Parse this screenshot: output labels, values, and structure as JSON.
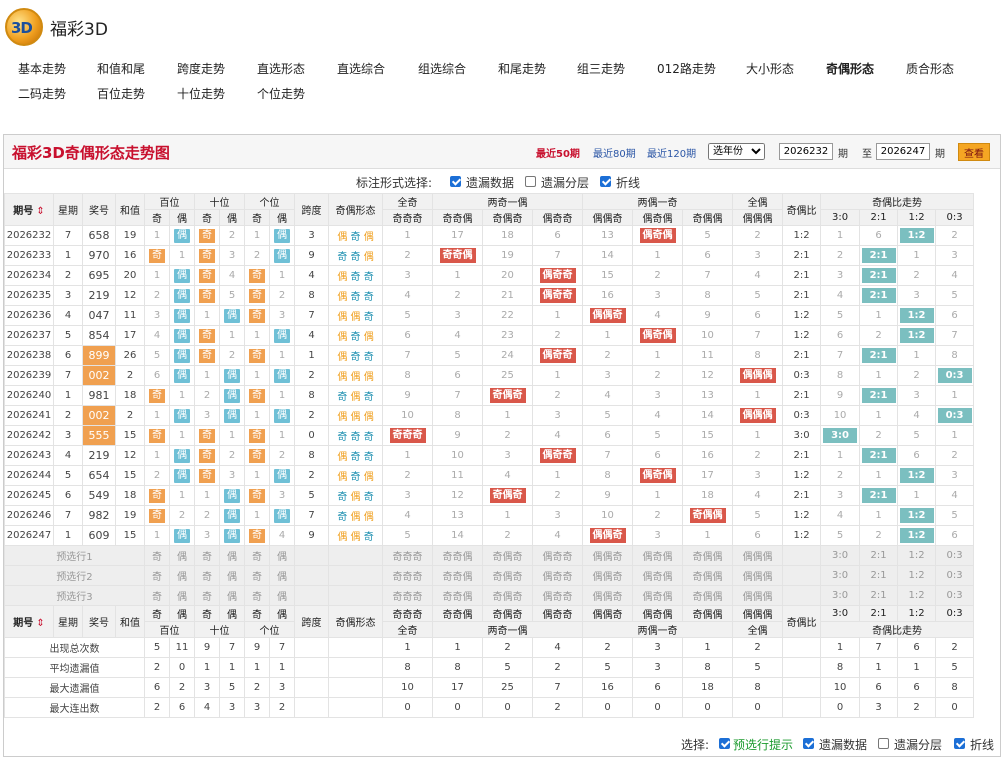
{
  "header": {
    "title": "福彩3D",
    "logo_text": "3D"
  },
  "nav": [
    "基本走势",
    "和值和尾",
    "跨度走势",
    "直选形态",
    "直选综合",
    "组选综合",
    "和尾走势",
    "组三走势",
    "012路走势",
    "大小形态",
    "奇偶形态",
    "质合形态",
    "二码走势",
    "百位走势",
    "十位走势",
    "个位走势"
  ],
  "nav_active": "奇偶形态",
  "panel": {
    "title": "福彩3D奇偶形态走势图",
    "links": [
      "最近50期",
      "最近80期",
      "最近120期"
    ],
    "year_select": "选年份",
    "from": "2026232",
    "to": "2026247",
    "qi1": "期",
    "zhi": "至",
    "qi2": "期",
    "btn": "查看"
  },
  "options": {
    "label": "标注形式选择:",
    "items": [
      {
        "label": "遗漏数据",
        "checked": true
      },
      {
        "label": "遗漏分层",
        "checked": false
      },
      {
        "label": "折线",
        "checked": true
      }
    ]
  },
  "table": {
    "head1": [
      "期号",
      "星期",
      "奖号",
      "和值",
      "百位",
      "十位",
      "个位",
      "跨度",
      "奇偶形态",
      "全奇",
      "两奇一偶",
      "两偶一奇",
      "全偶",
      "奇偶比",
      "奇偶比走势"
    ],
    "head2": [
      "奇",
      "偶",
      "奇",
      "偶",
      "奇",
      "偶",
      "奇奇奇",
      "奇奇偶",
      "奇偶奇",
      "偶奇奇",
      "偶偶奇",
      "偶奇偶",
      "奇偶偶",
      "偶偶偶",
      "3:0",
      "2:1",
      "1:2",
      "0:3"
    ],
    "rows": [
      {
        "p": "2026232",
        "w": "7",
        "n": "658",
        "s": "19",
        "pos": [
          [
            1,
            "偶"
          ],
          [
            "奇",
            2
          ],
          [
            1,
            "偶"
          ]
        ],
        "k": "3",
        "f": "偶奇偶",
        "c": [
          "1",
          "17",
          "18",
          "6",
          "13",
          "偶奇偶",
          "5",
          "2"
        ],
        "r": "1:2",
        "rt": [
          "1",
          "6",
          "1:2",
          "2"
        ]
      },
      {
        "p": "2026233",
        "w": "1",
        "n": "970",
        "s": "16",
        "pos": [
          [
            "奇",
            1
          ],
          [
            "奇",
            3
          ],
          [
            2,
            "偶"
          ]
        ],
        "k": "9",
        "f": "奇奇偶",
        "c": [
          "2",
          "奇奇偶",
          "19",
          "7",
          "14",
          "1",
          "6",
          "3"
        ],
        "r": "2:1",
        "rt": [
          "2",
          "2:1",
          "1",
          "3"
        ]
      },
      {
        "p": "2026234",
        "w": "2",
        "n": "695",
        "s": "20",
        "pos": [
          [
            1,
            "偶"
          ],
          [
            "奇",
            4
          ],
          [
            "奇",
            1
          ]
        ],
        "k": "4",
        "f": "偶奇奇",
        "c": [
          "3",
          "1",
          "20",
          "偶奇奇",
          "15",
          "2",
          "7",
          "4"
        ],
        "r": "2:1",
        "rt": [
          "3",
          "2:1",
          "2",
          "4"
        ]
      },
      {
        "p": "2026235",
        "w": "3",
        "n": "219",
        "s": "12",
        "pos": [
          [
            2,
            "偶"
          ],
          [
            "奇",
            5
          ],
          [
            "奇",
            2
          ]
        ],
        "k": "8",
        "f": "偶奇奇",
        "c": [
          "4",
          "2",
          "21",
          "偶奇奇",
          "16",
          "3",
          "8",
          "5"
        ],
        "r": "2:1",
        "rt": [
          "4",
          "2:1",
          "3",
          "5"
        ]
      },
      {
        "p": "2026236",
        "w": "4",
        "n": "047",
        "s": "11",
        "pos": [
          [
            3,
            "偶"
          ],
          [
            1,
            "偶"
          ],
          [
            "奇",
            3
          ]
        ],
        "k": "7",
        "f": "偶偶奇",
        "c": [
          "5",
          "3",
          "22",
          "1",
          "偶偶奇",
          "4",
          "9",
          "6"
        ],
        "r": "1:2",
        "rt": [
          "5",
          "1",
          "1:2",
          "6"
        ]
      },
      {
        "p": "2026237",
        "w": "5",
        "n": "854",
        "s": "17",
        "pos": [
          [
            4,
            "偶"
          ],
          [
            "奇",
            1
          ],
          [
            1,
            "偶"
          ]
        ],
        "k": "4",
        "f": "偶奇偶",
        "c": [
          "6",
          "4",
          "23",
          "2",
          "1",
          "偶奇偶",
          "10",
          "7"
        ],
        "r": "1:2",
        "rt": [
          "6",
          "2",
          "1:2",
          "7"
        ]
      },
      {
        "p": "2026238",
        "w": "6",
        "n": "899",
        "s": "26",
        "pos": [
          [
            5,
            "偶"
          ],
          [
            "奇",
            2
          ],
          [
            "奇",
            1
          ]
        ],
        "k": "1",
        "f": "偶奇奇",
        "c": [
          "7",
          "5",
          "24",
          "偶奇奇",
          "2",
          "1",
          "11",
          "8"
        ],
        "r": "2:1",
        "rt": [
          "7",
          "2:1",
          "1",
          "8"
        ]
      },
      {
        "p": "2026239",
        "w": "7",
        "n": "002",
        "s": "2",
        "pos": [
          [
            6,
            "偶"
          ],
          [
            1,
            "偶"
          ],
          [
            1,
            "偶"
          ]
        ],
        "k": "2",
        "f": "偶偶偶",
        "c": [
          "8",
          "6",
          "25",
          "1",
          "3",
          "2",
          "12",
          "偶偶偶"
        ],
        "r": "0:3",
        "rt": [
          "8",
          "1",
          "2",
          "0:3"
        ]
      },
      {
        "p": "2026240",
        "w": "1",
        "n": "981",
        "s": "18",
        "pos": [
          [
            "奇",
            1
          ],
          [
            2,
            "偶"
          ],
          [
            "奇",
            1
          ]
        ],
        "k": "8",
        "f": "奇偶奇",
        "c": [
          "9",
          "7",
          "奇偶奇",
          "2",
          "4",
          "3",
          "13",
          "1"
        ],
        "r": "2:1",
        "rt": [
          "9",
          "2:1",
          "3",
          "1"
        ]
      },
      {
        "p": "2026241",
        "w": "2",
        "n": "002",
        "s": "2",
        "pos": [
          [
            1,
            "偶"
          ],
          [
            3,
            "偶"
          ],
          [
            1,
            "偶"
          ]
        ],
        "k": "2",
        "f": "偶偶偶",
        "c": [
          "10",
          "8",
          "1",
          "3",
          "5",
          "4",
          "14",
          "偶偶偶"
        ],
        "r": "0:3",
        "rt": [
          "10",
          "1",
          "4",
          "0:3"
        ]
      },
      {
        "p": "2026242",
        "w": "3",
        "n": "555",
        "s": "15",
        "pos": [
          [
            "奇",
            1
          ],
          [
            "奇",
            1
          ],
          [
            "奇",
            1
          ]
        ],
        "k": "0",
        "f": "奇奇奇",
        "c": [
          "奇奇奇",
          "9",
          "2",
          "4",
          "6",
          "5",
          "15",
          "1"
        ],
        "r": "3:0",
        "rt": [
          "3:0",
          "2",
          "5",
          "1"
        ]
      },
      {
        "p": "2026243",
        "w": "4",
        "n": "219",
        "s": "12",
        "pos": [
          [
            1,
            "偶"
          ],
          [
            "奇",
            2
          ],
          [
            "奇",
            2
          ]
        ],
        "k": "8",
        "f": "偶奇奇",
        "c": [
          "1",
          "10",
          "3",
          "偶奇奇",
          "7",
          "6",
          "16",
          "2"
        ],
        "r": "2:1",
        "rt": [
          "1",
          "2:1",
          "6",
          "2"
        ]
      },
      {
        "p": "2026244",
        "w": "5",
        "n": "654",
        "s": "15",
        "pos": [
          [
            2,
            "偶"
          ],
          [
            "奇",
            3
          ],
          [
            1,
            "偶"
          ]
        ],
        "k": "2",
        "f": "偶奇偶",
        "c": [
          "2",
          "11",
          "4",
          "1",
          "8",
          "偶奇偶",
          "17",
          "3"
        ],
        "r": "1:2",
        "rt": [
          "2",
          "1",
          "1:2",
          "3"
        ]
      },
      {
        "p": "2026245",
        "w": "6",
        "n": "549",
        "s": "18",
        "pos": [
          [
            "奇",
            1
          ],
          [
            1,
            "偶"
          ],
          [
            "奇",
            3
          ]
        ],
        "k": "5",
        "f": "奇偶奇",
        "c": [
          "3",
          "12",
          "奇偶奇",
          "2",
          "9",
          "1",
          "18",
          "4"
        ],
        "r": "2:1",
        "rt": [
          "3",
          "2:1",
          "1",
          "4"
        ]
      },
      {
        "p": "2026246",
        "w": "7",
        "n": "982",
        "s": "19",
        "pos": [
          [
            "奇",
            2
          ],
          [
            2,
            "偶"
          ],
          [
            1,
            "偶"
          ]
        ],
        "k": "7",
        "f": "奇偶偶",
        "c": [
          "4",
          "13",
          "1",
          "3",
          "10",
          "2",
          "奇偶偶",
          "5"
        ],
        "r": "1:2",
        "rt": [
          "4",
          "1",
          "1:2",
          "5"
        ]
      },
      {
        "p": "2026247",
        "w": "1",
        "n": "609",
        "s": "15",
        "pos": [
          [
            1,
            "偶"
          ],
          [
            3,
            "偶"
          ],
          [
            "奇",
            4
          ]
        ],
        "k": "9",
        "f": "偶偶奇",
        "c": [
          "5",
          "14",
          "2",
          "4",
          "偶偶奇",
          "3",
          "1",
          "6"
        ],
        "r": "1:2",
        "rt": [
          "5",
          "2",
          "1:2",
          "6"
        ]
      }
    ],
    "pre": [
      "预选行1",
      "预选行2",
      "预选行3"
    ],
    "stats": [
      {
        "l": "出现总次数",
        "v": [
          "5",
          "11",
          "9",
          "7",
          "9",
          "7"
        ],
        "c": [
          "1",
          "1",
          "2",
          "4",
          "2",
          "3",
          "1",
          "2"
        ],
        "rt": [
          "1",
          "7",
          "6",
          "2"
        ]
      },
      {
        "l": "平均遗漏值",
        "v": [
          "2",
          "0",
          "1",
          "1",
          "1",
          "1"
        ],
        "c": [
          "8",
          "8",
          "5",
          "2",
          "5",
          "3",
          "8",
          "5"
        ],
        "rt": [
          "8",
          "1",
          "1",
          "5"
        ]
      },
      {
        "l": "最大遗漏值",
        "v": [
          "6",
          "2",
          "3",
          "5",
          "2",
          "3"
        ],
        "c": [
          "10",
          "17",
          "25",
          "7",
          "16",
          "6",
          "18",
          "8"
        ],
        "rt": [
          "10",
          "6",
          "6",
          "8"
        ]
      },
      {
        "l": "最大连出数",
        "v": [
          "2",
          "6",
          "4",
          "3",
          "3",
          "2"
        ],
        "c": [
          "0",
          "0",
          "0",
          "2",
          "0",
          "0",
          "0",
          "0"
        ],
        "rt": [
          "0",
          "3",
          "2",
          "0"
        ]
      }
    ]
  },
  "footer": {
    "label": "选择:",
    "items": [
      {
        "label": "预选行提示",
        "checked": true
      },
      {
        "label": "遗漏数据",
        "checked": true
      },
      {
        "label": "遗漏分层",
        "checked": false
      },
      {
        "label": "折线",
        "checked": true
      }
    ]
  }
}
